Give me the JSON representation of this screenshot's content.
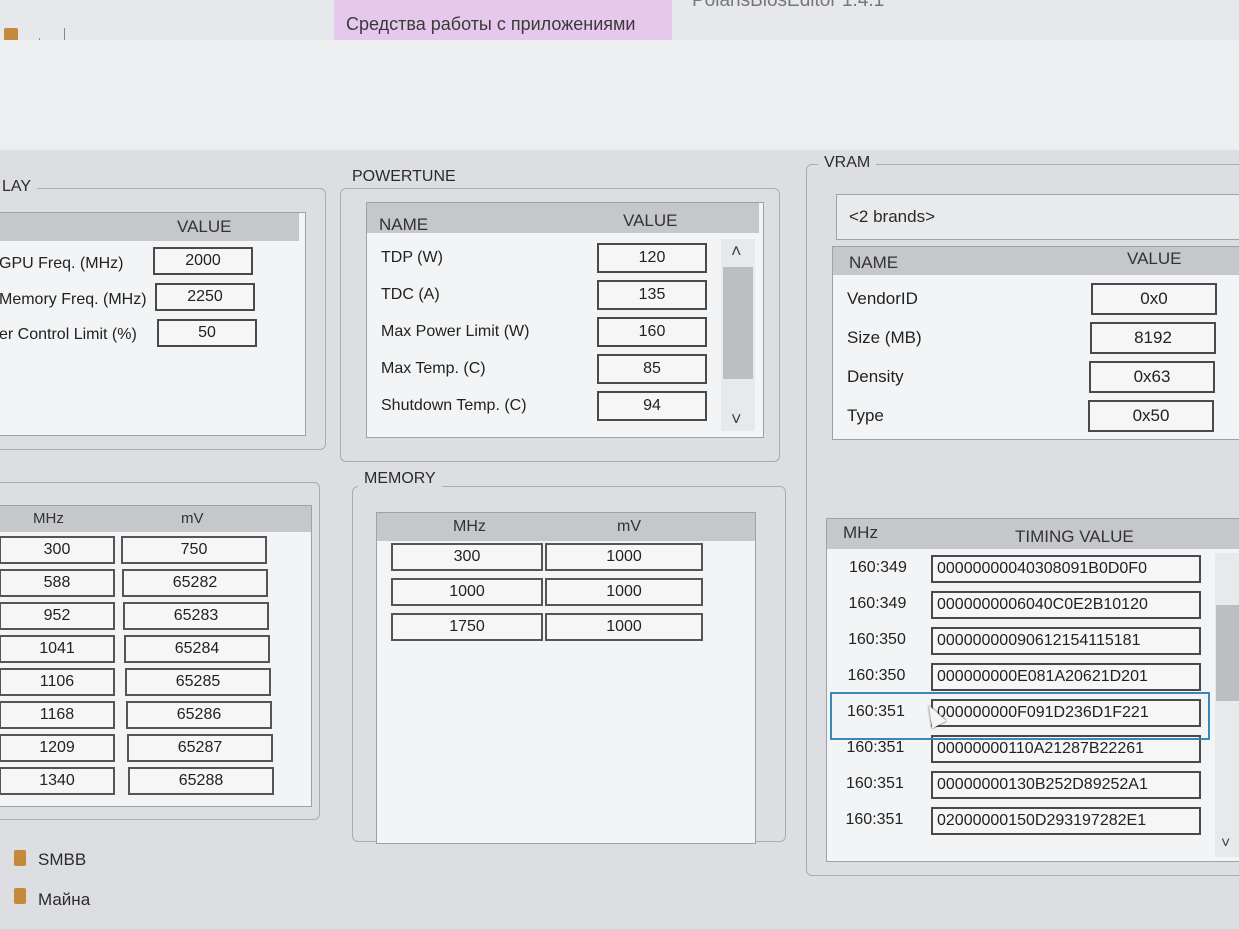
{
  "titlebar": {
    "quick_access_arrow": "↓",
    "tools_tab": "Средства работы с приложениями",
    "app_tab": "PolarisBiosEditor 1.4.1"
  },
  "overclock": {
    "title": "LAY",
    "header_value": "VALUE",
    "rows": [
      {
        "name": "GPU Freq. (MHz)",
        "value": "2000"
      },
      {
        "name": "Memory Freq. (MHz)",
        "value": "2250"
      },
      {
        "name": "er Control Limit (%)",
        "value": "50"
      }
    ]
  },
  "gpu_table": {
    "header_mhz": "MHz",
    "header_mv": "mV",
    "rows": [
      {
        "mhz": "300",
        "mv": "750"
      },
      {
        "mhz": "588",
        "mv": "65282"
      },
      {
        "mhz": "952",
        "mv": "65283"
      },
      {
        "mhz": "1041",
        "mv": "65284"
      },
      {
        "mhz": "1106",
        "mv": "65285"
      },
      {
        "mhz": "1168",
        "mv": "65286"
      },
      {
        "mhz": "1209",
        "mv": "65287"
      },
      {
        "mhz": "1340",
        "mv": "65288"
      }
    ]
  },
  "powertune": {
    "title": "POWERTUNE",
    "header_name": "NAME",
    "header_value": "VALUE",
    "rows": [
      {
        "name": "TDP (W)",
        "value": "120"
      },
      {
        "name": "TDC (A)",
        "value": "135"
      },
      {
        "name": "Max Power Limit (W)",
        "value": "160"
      },
      {
        "name": "Max Temp. (C)",
        "value": "85"
      },
      {
        "name": "Shutdown Temp. (C)",
        "value": "94"
      }
    ],
    "scroll_up": "˄",
    "scroll_down": "˅"
  },
  "memory": {
    "title": "MEMORY",
    "header_mhz": "MHz",
    "header_mv": "mV",
    "rows": [
      {
        "mhz": "300",
        "mv": "1000"
      },
      {
        "mhz": "1000",
        "mv": "1000"
      },
      {
        "mhz": "1750",
        "mv": "1000"
      }
    ]
  },
  "vram": {
    "title": "VRAM",
    "brands": "<2 brands>",
    "header_name": "NAME",
    "header_value": "VALUE",
    "rows": [
      {
        "name": "VendorID",
        "value": "0x0"
      },
      {
        "name": "Size (MB)",
        "value": "8192"
      },
      {
        "name": "Density",
        "value": "0x63"
      },
      {
        "name": "Type",
        "value": "0x50"
      }
    ]
  },
  "timings": {
    "header_mhz": "MHz",
    "header_value": "TIMING VALUE",
    "rows": [
      {
        "mhz": "160:349",
        "value": "00000000040308091B0D0F0"
      },
      {
        "mhz": "160:349",
        "value": "0000000006040C0E2B10120"
      },
      {
        "mhz": "160:350",
        "value": "00000000090612154115181"
      },
      {
        "mhz": "160:350",
        "value": "000000000E081A20621D201"
      },
      {
        "mhz": "160:351",
        "value": "000000000F091D236D1F221"
      },
      {
        "mhz": "160:351",
        "value": "00000000110A21287B22261"
      },
      {
        "mhz": "160:351",
        "value": "00000000130B252D89252A1"
      },
      {
        "mhz": "160:351",
        "value": "02000000150D293197282E1"
      }
    ],
    "scroll_down": "˅"
  },
  "explorer": {
    "items": [
      "SMBB",
      "Майна"
    ]
  }
}
